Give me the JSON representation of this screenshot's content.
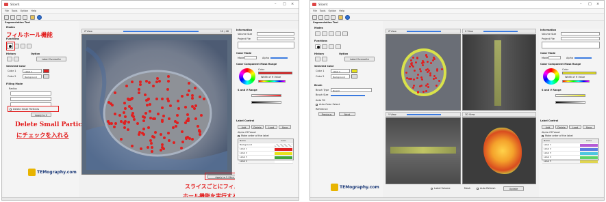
{
  "left_window": {
    "title": "Slicer4",
    "menu": [
      "File",
      "Tools",
      "Option",
      "Help"
    ],
    "panel_title": "Segmentation Tool",
    "mode_label": "Modes",
    "functions_label": "Functions",
    "history_label": "History",
    "option_label": "Option",
    "label_overwrite": "Label Overwrite",
    "selected_color": "Selected Color",
    "color1": "Color 1",
    "color2": "Color 2",
    "label1": "Label 1",
    "background": "Background",
    "filling_mode": "Filling Mode",
    "radius": "Radius",
    "delete_small_particles": "Delete Small Particles",
    "apply_to": "Apply to 2",
    "view_label": "Z View",
    "info_header": "Information",
    "volume_size": "Volume Size",
    "project_file": "Project File",
    "color_mode": "Color Mode",
    "mode_text": "Mode",
    "alpha": "Alpha",
    "color_component_mask_range": "Color Component Mask Range",
    "color": "Color",
    "width_h": "Width of H Value",
    "s_v_range": "S and V Range",
    "label_control": "Label Control",
    "add": "Add",
    "delete": "Delete",
    "load": "Load",
    "save": "Save",
    "alpha_off": "Alpha Off Voxel",
    "make_order": "Make order of the label",
    "name_col": "Name",
    "color_col": "Color",
    "labels": [
      "Background",
      "Label 1",
      "Label 2",
      "Label 3",
      "Label 4"
    ],
    "apply_all": "Apply to 2 Slice",
    "slice_value": "10 / 48",
    "logo": "TEMography.com"
  },
  "right_window": {
    "title": "Slicer4",
    "panel_title": "Segmentation Tool",
    "views": [
      "Z View",
      "X View",
      "Y View",
      "3D View"
    ],
    "label_volume": "Label Volume",
    "mesh": "Mesh",
    "auto_refresh": "Auto Refresh",
    "update": "Update",
    "brush_label": "Brush",
    "brush_type": "Brush Type",
    "round": "Round",
    "brush_size": "Brush Size",
    "auto_fill": "Auto Fill",
    "auto_color_select": "Auto Color Select",
    "reference": "Reference",
    "previous": "Previous",
    "next": "Next",
    "logo": "TEMography.com",
    "labels": [
      "Label 1",
      "Label 2",
      "Label 3",
      "Label 4",
      "Label 5"
    ]
  },
  "annotations": {
    "fill_hole": "フィルホール機能",
    "delete_particles_line1": "Delete Small Particles",
    "delete_particles_line2": "にチェックを入れる",
    "slice_fill_line1": "スライスごとにフィル",
    "slice_fill_line2": "ホール機能を実行する"
  },
  "colors": {
    "annotation_red": "#e21b1b",
    "annotation_blue": "#1d3fb3",
    "label_red": "#e02020",
    "label_yellow": "#e7e21b",
    "label_green": "#3fa63a"
  }
}
